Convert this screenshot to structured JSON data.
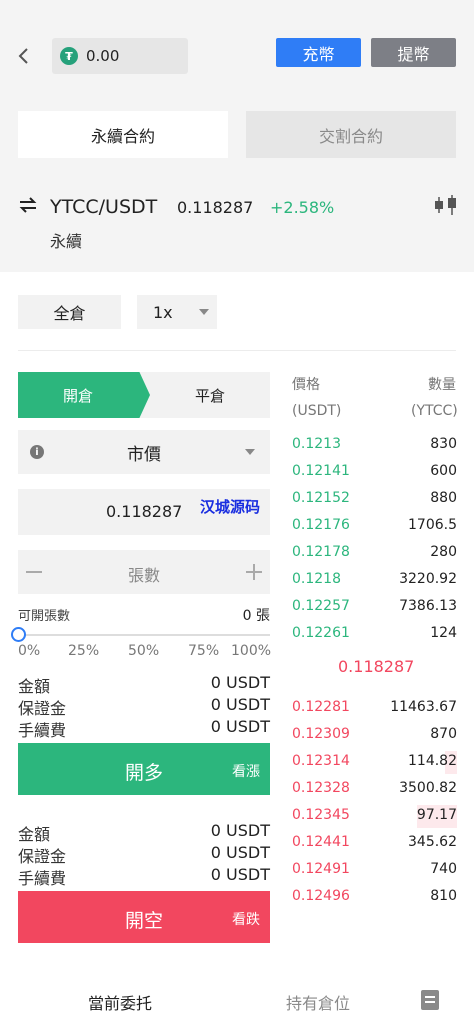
{
  "header": {
    "balance": "0.00",
    "balance_icon": "usdt-icon",
    "deposit_label": "充幣",
    "withdraw_label": "提幣"
  },
  "contract_tabs": [
    "永續合約",
    "交割合約"
  ],
  "ticker": {
    "pair": "YTCC/USDT",
    "price": "0.118287",
    "change": "+2.58%",
    "type_label": "永續"
  },
  "margin": {
    "mode": "全倉",
    "leverage": "1x"
  },
  "trade": {
    "open_label": "開倉",
    "close_label": "平倉",
    "order_type": "市價",
    "price_value": "0.118287",
    "watermark": "汉城源码",
    "qty_placeholder": "張數",
    "avail_label": "可開張數",
    "avail_value": "0 張",
    "slider_value": 0,
    "percents": [
      "0%",
      "25%",
      "50%",
      "75%",
      "100%"
    ]
  },
  "long_summary": [
    {
      "label": "金額",
      "value": "0 USDT"
    },
    {
      "label": "保證金",
      "value": "0 USDT"
    },
    {
      "label": "手續費",
      "value": "0 USDT"
    }
  ],
  "long_button": {
    "label": "開多",
    "side": "看漲"
  },
  "short_summary": [
    {
      "label": "金額",
      "value": "0 USDT"
    },
    {
      "label": "保證金",
      "value": "0 USDT"
    },
    {
      "label": "手續費",
      "value": "0 USDT"
    }
  ],
  "short_button": {
    "label": "開空",
    "side": "看跌"
  },
  "orderbook": {
    "price_header": "價格",
    "qty_header": "數量",
    "price_unit": "(USDT)",
    "qty_unit": "(YTCC)",
    "bids": [
      {
        "price": "0.1213",
        "qty": "830"
      },
      {
        "price": "0.12141",
        "qty": "600"
      },
      {
        "price": "0.12152",
        "qty": "880"
      },
      {
        "price": "0.12176",
        "qty": "1706.5"
      },
      {
        "price": "0.12178",
        "qty": "280"
      },
      {
        "price": "0.1218",
        "qty": "3220.92"
      },
      {
        "price": "0.12257",
        "qty": "7386.13"
      },
      {
        "price": "0.12261",
        "qty": "124"
      }
    ],
    "mid_price": "0.118287",
    "asks": [
      {
        "price": "0.12281",
        "qty": "11463.67"
      },
      {
        "price": "0.12309",
        "qty": "870"
      },
      {
        "price": "0.12314",
        "qty": "114.82"
      },
      {
        "price": "0.12328",
        "qty": "3500.82"
      },
      {
        "price": "0.12345",
        "qty": "97.17"
      },
      {
        "price": "0.12441",
        "qty": "345.62"
      },
      {
        "price": "0.12491",
        "qty": "740"
      },
      {
        "price": "0.12496",
        "qty": "810"
      }
    ]
  },
  "bottom_tabs": [
    "當前委托",
    "持有倉位"
  ],
  "colors": {
    "buy": "#2cb67d",
    "sell": "#f2475f",
    "primary": "#2f7df6"
  }
}
